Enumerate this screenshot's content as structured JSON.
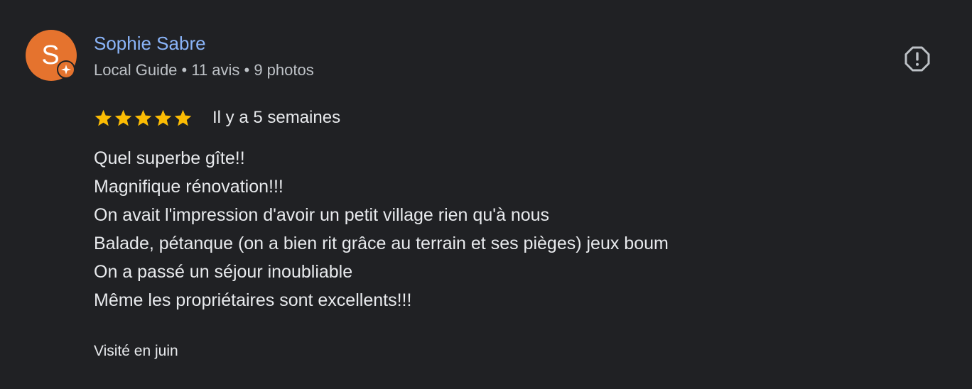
{
  "author": {
    "initial": "S",
    "name": "Sophie Sabre",
    "meta": "Local Guide • 11 avis • 9 photos",
    "avatar_color": "#e5732e",
    "badge_icon": "local-guide-sparkle-icon"
  },
  "review": {
    "rating": 5,
    "rating_max": 5,
    "star_color": "#fbbc04",
    "date": "Il y a 5 semaines",
    "text_lines": [
      "Quel superbe gîte!!",
      "Magnifique rénovation!!!",
      "On avait l'impression d'avoir un petit village rien qu'à nous",
      "Balade, pétanque (on a bien rit grâce au terrain et ses pièges) jeux boum",
      "On a passé un séjour inoubliable",
      "Même les propriétaires sont excellents!!!"
    ],
    "visit": "Visité en juin"
  },
  "actions": {
    "report_icon": "report-icon"
  },
  "colors": {
    "background": "#202124",
    "link": "#8ab4f8",
    "secondary_text": "#bdc1c6",
    "primary_text": "#e8eaed"
  }
}
